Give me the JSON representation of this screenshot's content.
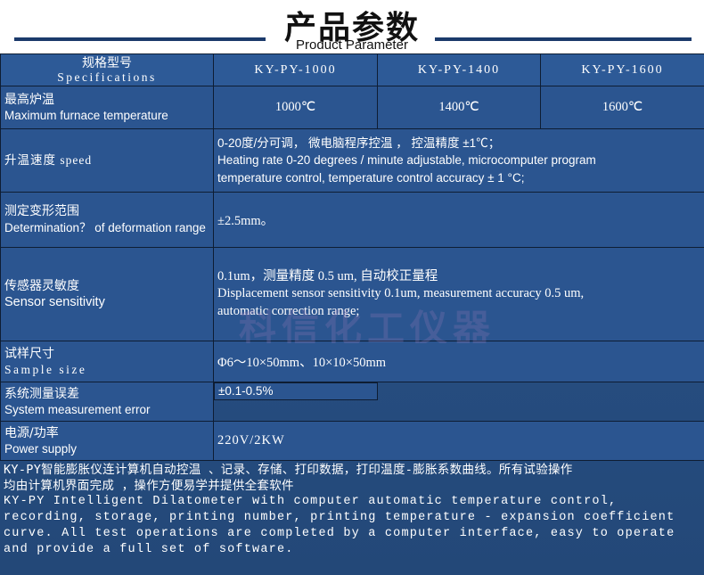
{
  "header": {
    "title_zh": "产品参数",
    "title_en": "Product Parameter"
  },
  "table": {
    "spec_label_cn": "规格型号",
    "spec_label_en": "Specifications",
    "models": [
      "KY-PY-1000",
      "KY-PY-1400",
      "KY-PY-1600"
    ],
    "max_temp": {
      "label_cn": "最高炉温",
      "label_en": "Maximum furnace temperature",
      "values": [
        "1000℃",
        "1400℃",
        "1600℃"
      ]
    },
    "speed": {
      "label": "升温速度 speed",
      "value_cn": "0-20度/分可调， 微电脑程序控温 ， 控温精度 ±1℃；",
      "value_en_1": "Heating rate 0-20 degrees / minute adjustable, microcomputer program",
      "value_en_2": "temperature control, temperature control accuracy ± 1 °C;"
    },
    "deformation": {
      "label_cn": "测定变形范围",
      "label_en": "Determination？ of deformation range",
      "value": "±2.5mm。"
    },
    "sensor": {
      "label_cn": "传感器灵敏度",
      "label_en": "Sensor sensitivity",
      "value_cn": "0.1um，测量精度 0.5 um, 自动校正量程",
      "value_en_1": "Displacement sensor sensitivity 0.1um, measurement accuracy 0.5 um,",
      "value_en_2": "automatic correction range;"
    },
    "sample": {
      "label_cn": "试样尺寸",
      "label_en": "Sample size",
      "value": "Φ6～10×50mm、10×10×50mm"
    },
    "error": {
      "label_cn": "系统测量误差",
      "label_en": "System measurement error",
      "value": "±0.1-0.5%"
    },
    "power": {
      "label_cn": "电源/功率",
      "label_en": "Power supply",
      "value": "220V/2KW"
    }
  },
  "watermark": "科信化工仪器",
  "footer": {
    "zh_1": "KY-PY智能膨胀仪连计算机自动控温 、记录、存储、打印数据，打印温度-膨胀系数曲线。所有试验操作",
    "zh_2": "均由计算机界面完成 ，操作方便易学并提供全套软件",
    "en_1": "KY-PY Intelligent Dilatometer with computer automatic temperature control,",
    "en_2": "recording, storage, printing number, printing temperature - expansion coefficient",
    "en_3": "curve. All test operations are completed by a computer interface, easy to operate",
    "en_4": "and provide a full set of software."
  }
}
